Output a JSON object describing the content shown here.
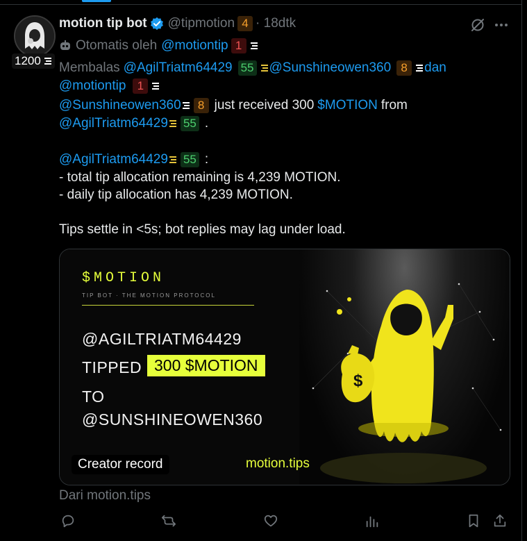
{
  "author": {
    "name": "motion tip bot",
    "handle": "@tipmotion",
    "handle_badge": "4",
    "time": "· 18dtk",
    "score": "1200"
  },
  "automated": {
    "prefix": "Otomatis oleh",
    "handle": "@motiontip",
    "badge": "1"
  },
  "reply": {
    "prefix": "Membalas",
    "user1": "@AgilTriatm64429",
    "user1_badge": "55",
    "user2": "@Sunshineowen360",
    "user2_badge": "8",
    "conj": "dan",
    "user3": "@motiontip",
    "user3_badge": "1"
  },
  "body": {
    "recipient": "@Sunshineowen360",
    "recipient_badge": "8",
    "received_text": "just received 300",
    "token": "$MOTION",
    "from_text": "from",
    "sender": "@AgilTriatm64429",
    "sender_badge": "55",
    "period": ".",
    "mention": "@AgilTriatm64429",
    "mention_badge": "55",
    "colon": ":",
    "line1": "- total tip allocation remaining is 4,239 MOTION.",
    "line2": "- daily tip allocation has 4,239 MOTION.",
    "footer": "Tips settle in <5s; bot replies may lag under load."
  },
  "card": {
    "brand": "$MOTION",
    "sub": "TIP BOT · THE MOTION PROTOCOL",
    "line1": "@AGILTRIATM64429",
    "line2": "TIPPED",
    "highlight": "300 $MOTION",
    "line3": "TO",
    "line4": "@SUNSHINEOWEN360",
    "pill": "Creator record",
    "url": "motion.tips",
    "bag_symbol": "$"
  },
  "source": "Dari motion.tips",
  "colors": {
    "accent": "#1d9bf0",
    "brand_yellow": "#e6ff3b",
    "badge_orange": "#f59e2b",
    "badge_red": "#f05555",
    "badge_green": "#4ccf6e"
  },
  "icons": [
    "verified-icon",
    "robot-icon",
    "stack-icon",
    "grok-icon",
    "more-icon",
    "reply-icon",
    "repost-icon",
    "like-icon",
    "views-icon",
    "bookmark-icon",
    "share-icon"
  ]
}
